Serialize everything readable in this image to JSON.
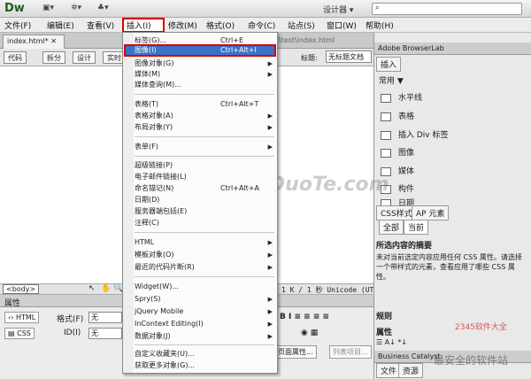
{
  "app": {
    "logo": "Dw",
    "workspace": "设计器 ▾",
    "search_placeholder": ""
  },
  "menubar": [
    "文件(F)",
    "编辑(E)",
    "查看(V)",
    "插入(I)",
    "修改(M)",
    "格式(O)",
    "命令(C)",
    "站点(S)",
    "窗口(W)",
    "帮助(H)"
  ],
  "document": {
    "tab": "index.html*",
    "path": "D:\\test\\index.html",
    "views": [
      "代码",
      "拆分",
      "设计",
      "实时"
    ],
    "title_label": "标题:",
    "title_value": "无标题文档",
    "status_tag": "<body>",
    "status_info": "1 K / 1 秒  Unicode (UT"
  },
  "insert_menu": {
    "items": [
      {
        "label": "标签(G)...",
        "shortcut": "Ctrl+E",
        "arrow": ""
      },
      {
        "label": "图像(I)",
        "shortcut": "Ctrl+Alt+I",
        "arrow": ""
      },
      {
        "label": "图像对象(G)",
        "shortcut": "",
        "arrow": "▶"
      },
      {
        "label": "媒体(M)",
        "shortcut": "",
        "arrow": "▶"
      },
      {
        "label": "媒体查询(M)...",
        "shortcut": "",
        "arrow": ""
      },
      {
        "label": "表格(T)",
        "shortcut": "Ctrl+Alt+T",
        "arrow": ""
      },
      {
        "label": "表格对象(A)",
        "shortcut": "",
        "arrow": "▶"
      },
      {
        "label": "布局对象(Y)",
        "shortcut": "",
        "arrow": "▶"
      },
      {
        "label": "表单(F)",
        "shortcut": "",
        "arrow": "▶"
      },
      {
        "label": "超级链接(P)",
        "shortcut": "",
        "arrow": ""
      },
      {
        "label": "电子邮件链接(L)",
        "shortcut": "",
        "arrow": ""
      },
      {
        "label": "命名锚记(N)",
        "shortcut": "Ctrl+Alt+A",
        "arrow": ""
      },
      {
        "label": "日期(D)",
        "shortcut": "",
        "arrow": ""
      },
      {
        "label": "服务器端包括(E)",
        "shortcut": "",
        "arrow": ""
      },
      {
        "label": "注释(C)",
        "shortcut": "",
        "arrow": ""
      },
      {
        "label": "HTML",
        "shortcut": "",
        "arrow": "▶"
      },
      {
        "label": "模板对象(O)",
        "shortcut": "",
        "arrow": "▶"
      },
      {
        "label": "最近的代码片断(R)",
        "shortcut": "",
        "arrow": "▶"
      },
      {
        "label": "Widget(W)...",
        "shortcut": "",
        "arrow": ""
      },
      {
        "label": "Spry(S)",
        "shortcut": "",
        "arrow": "▶"
      },
      {
        "label": "jQuery Mobile",
        "shortcut": "",
        "arrow": "▶"
      },
      {
        "label": "InContext Editing(I)",
        "shortcut": "",
        "arrow": "▶"
      },
      {
        "label": "数据对象(J)",
        "shortcut": "",
        "arrow": "▶"
      },
      {
        "label": "自定义收藏夹(U)...",
        "shortcut": "",
        "arrow": ""
      },
      {
        "label": "获取更多对象(G)...",
        "shortcut": "",
        "arrow": ""
      }
    ]
  },
  "properties": {
    "title": "属性",
    "html_btn": "HTML",
    "css_btn": "CSS",
    "format_label": "格式(F)",
    "format_value": "无",
    "id_label": "ID(I)",
    "id_value": "无",
    "page_props": "页面属性...",
    "list_item": "列表项目..."
  },
  "right_panel": {
    "header": "Adobe BrowserLab",
    "insert_tab": "插入",
    "category": "常用 ▼",
    "items": [
      "水平线",
      "表格",
      "插入 Div 标签",
      "图像",
      "媒体",
      "构件",
      "日期"
    ],
    "css_tabs": [
      "CSS样式",
      "AP 元素"
    ],
    "mode_tabs": [
      "全部",
      "当前"
    ],
    "summary_title": "所选内容的摘要",
    "summary_text": "未对当前选定内容应用任何 CSS 属性。请选择一个带样式的元素，查看应用了哪些 CSS 属性。",
    "rules_title": "规则",
    "props_title": "属性",
    "bottom_panel": "Business Catalyst",
    "bottom_tabs": [
      "文件",
      "资源"
    ]
  },
  "watermarks": {
    "center": "www.DuoTe.com",
    "corner_red": "2345软件大全",
    "corner_gray": "最安全的软件站"
  }
}
